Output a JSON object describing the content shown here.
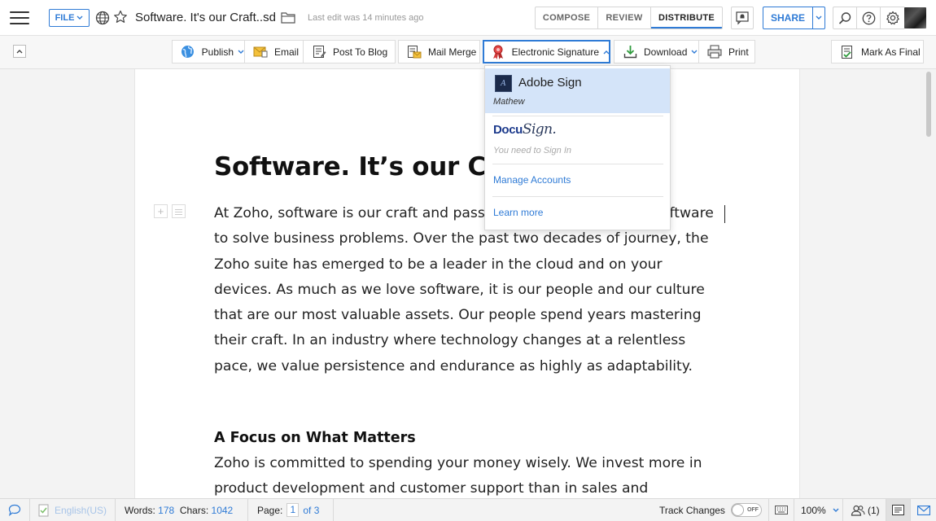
{
  "topbar": {
    "file_label": "FILE",
    "doc_title": "Software. It's our Craft..sd",
    "last_edit": "Last edit was 14 minutes ago",
    "tabs": [
      {
        "label": "COMPOSE",
        "active": false
      },
      {
        "label": "REVIEW",
        "active": false
      },
      {
        "label": "DISTRIBUTE",
        "active": true
      }
    ],
    "share_label": "SHARE",
    "icons": [
      "search-icon",
      "help-icon",
      "settings-icon"
    ]
  },
  "toolbar": {
    "buttons": [
      {
        "label": "Publish",
        "icon": "globe-icon",
        "caret": true
      },
      {
        "label": "Email",
        "icon": "email-icon",
        "caret": false
      },
      {
        "label": "Post To Blog",
        "icon": "blog-icon",
        "caret": false
      },
      {
        "label": "Mail Merge",
        "icon": "mail-merge-icon",
        "caret": false
      },
      {
        "label": "Electronic Signature",
        "icon": "ribbon-icon",
        "caret": true,
        "active": true
      },
      {
        "label": "Download",
        "icon": "download-icon",
        "caret": true
      },
      {
        "label": "Print",
        "icon": "printer-icon",
        "caret": false
      },
      {
        "label": "Mark As Final",
        "icon": "final-doc-icon",
        "caret": false
      }
    ]
  },
  "signature_menu": {
    "adobe": {
      "name": "Adobe Sign",
      "logo_text": "A",
      "user": "Mathew"
    },
    "docusign": {
      "logo_docu": "Docu",
      "logo_sign": "Sign.",
      "note": "You need to Sign In"
    },
    "manage_accounts": "Manage Accounts",
    "learn_more": "Learn more"
  },
  "document": {
    "heading": "Software. It’s our Cra",
    "paragraph1": [
      "At Zoho, software is our craft and pass",
      "to solve business problems. Over the past two decades of  journey, the",
      "Zoho suite has emerged to be a leader in the cloud and on your",
      "devices.   As much as we love software, it is our people and our culture",
      "that are our most valuable assets. Our people spend years mastering",
      "their  craft. In an industry where technology changes at a relentless",
      "pace, we value persistence and endurance as highly as adaptability."
    ],
    "paragraph1_right_fragment": "oftware",
    "subheading": "A Focus on What Matters",
    "paragraph2": [
      "Zoho is committed to spending your money wisely. We invest more in",
      "product development and customer support than in sales and"
    ]
  },
  "statusbar": {
    "language": "English(US)",
    "words_label": "Words:",
    "words": "178",
    "chars_label": "Chars:",
    "chars": "1042",
    "page_label": "Page:",
    "page_current": "1",
    "page_total": "of 3",
    "track_changes_label": "Track Changes",
    "track_changes_state": "OFF",
    "zoom": "100%",
    "collaborators": "(1)"
  },
  "colors": {
    "accent": "#2f7bd6",
    "menu_highlight": "#d4e4f9",
    "docusign_blue": "#1c3a8c"
  }
}
